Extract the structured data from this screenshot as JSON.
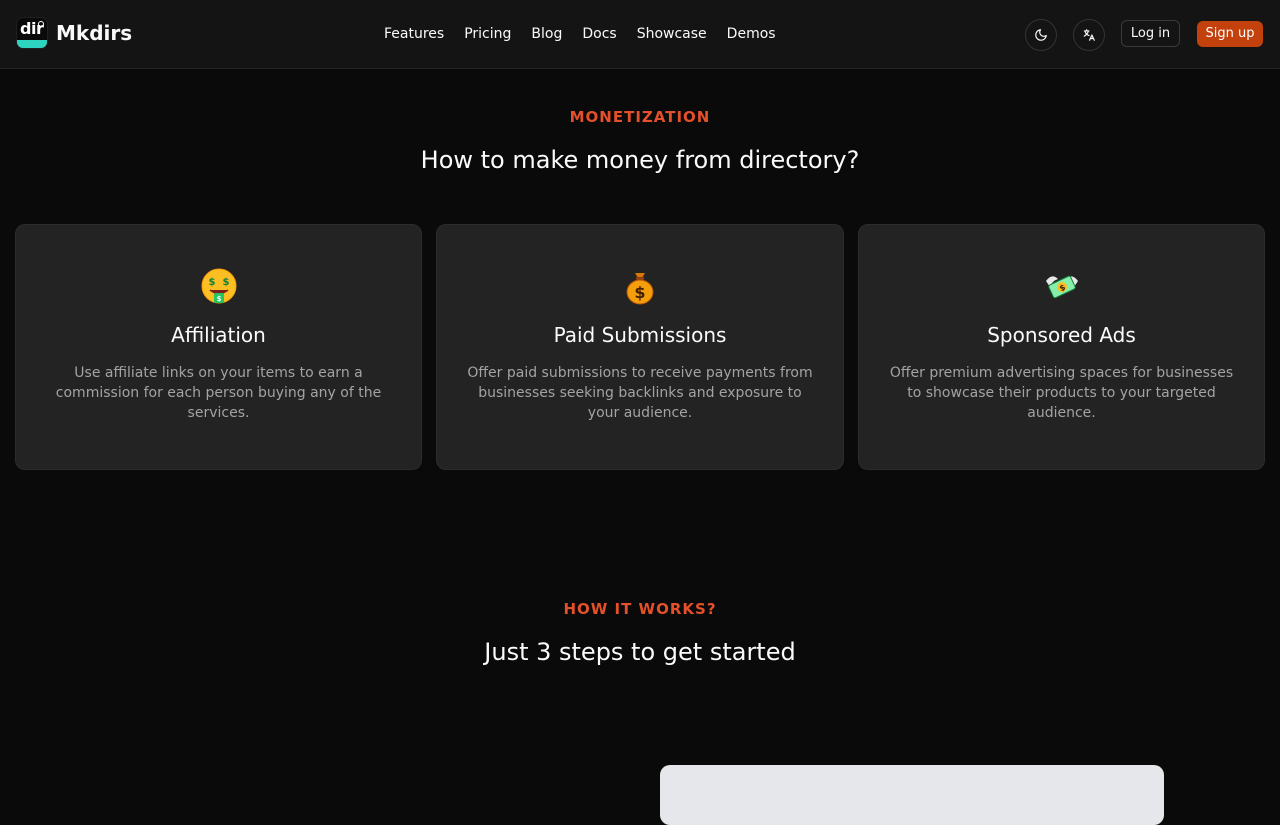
{
  "app": {
    "name": "Mkdirs",
    "logo_text": "dir"
  },
  "nav": {
    "items": [
      "Features",
      "Pricing",
      "Blog",
      "Docs",
      "Showcase",
      "Demos"
    ]
  },
  "actions": {
    "login_label": "Log in",
    "signup_label": "Sign up"
  },
  "monetization": {
    "eyebrow": "MONETIZATION",
    "title": "How to make money from directory?",
    "cards": [
      {
        "icon": "money-mouth-face-icon",
        "title": "Affiliation",
        "description": "Use affiliate links on your items to earn a commission for each person buying any of the services."
      },
      {
        "icon": "money-bag-icon",
        "title": "Paid Submissions",
        "description": "Offer paid submissions to receive payments from businesses seeking backlinks and exposure to your audience."
      },
      {
        "icon": "money-with-wings-icon",
        "title": "Sponsored Ads",
        "description": "Offer premium advertising spaces for businesses to showcase their products to your targeted audience."
      }
    ]
  },
  "how_it_works": {
    "eyebrow": "HOW IT WORKS?",
    "title": "Just 3 steps to get started"
  },
  "colors": {
    "accent": "#e4502a",
    "signup_bg": "#c2410c",
    "background": "#0a0a0a",
    "card_bg": "#232323"
  }
}
